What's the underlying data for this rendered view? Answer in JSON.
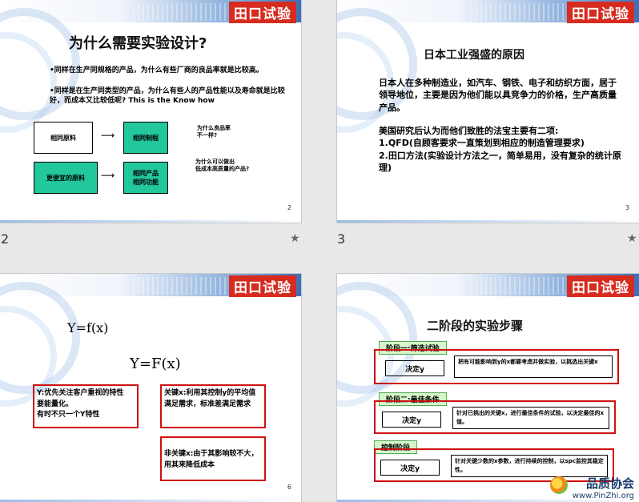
{
  "brand": "田口试验",
  "labels": {
    "left_num": "2",
    "mid_num": "3"
  },
  "star": "★",
  "slide2": {
    "title": "为什么需要实验设计?",
    "bullet1": "•同样在生产同规格的产品，为什么有些厂商的良品率就是比较高。",
    "bullet2": "•同样是在生产同类型的产品，为什么有些人的产品性能以及寿命就是比较好，而成本又比较低呢? This is the Know how",
    "box_same_material": "相同原料",
    "box_same_process": "相同制程",
    "box_cheaper_material": "更便宜的原料",
    "box_same_product_1": "相同产品",
    "box_same_product_2": "相同功能",
    "q1_line1": "为什么良品率",
    "q1_line2": "不一样?",
    "q2_line1": "为什么可以做出",
    "q2_line2": "低成本高质量的产品?",
    "page": "2"
  },
  "slide3": {
    "title": "日本工业强盛的原因",
    "para1": "日本人在多种制造业，如汽车、钢铁、电子和纺织方面，居于领导地位，主要是因为他们能以具竞争力的价格，生产高质量产品。",
    "para2_line1": "美国研究后认为而他们致胜的法宝主要有二项:",
    "para2_line2": "1.QFD(自顾客要求一直策划到相应的制造管理要求)",
    "para2_line3": "2.田口方法(实验设计方法之一，简单易用，没有复杂的统计原理)",
    "page": "3"
  },
  "slide6": {
    "eq1": "Y=f(x)",
    "eq2": "Y=F(x)",
    "box1_line1": "Y:优先关注客户重视的特性",
    "box1_line2": "要能量化。",
    "box1_line3": "有时不只一个Y特性",
    "box2": "关键x:利用其控制y的平均值满足需求，标准差满足需求",
    "box3": "非关键x:由于其影响较不大，用其来降低成本",
    "page": "6"
  },
  "slide7": {
    "title": "二阶段的实验步骤",
    "stage1": "阶段一:筛选试验",
    "stage1_box": "决定y",
    "stage1_desc": "把有可能影响到y的x都要考虑并做实验，以挑选出关键x",
    "stage2": "阶段二:最佳条件",
    "stage2_box": "决定y",
    "stage2_desc": "针对已挑出的关键x，进行最佳条件的试验，以决定最佳的x值。",
    "stage3": "控制阶段",
    "stage3_box": "决定y",
    "stage3_desc": "针对关键少数的x参数，进行持续的控制，以spc监控其稳定性。"
  },
  "watermark": {
    "name": "品质协会",
    "url": "www.PinZhi.org"
  }
}
